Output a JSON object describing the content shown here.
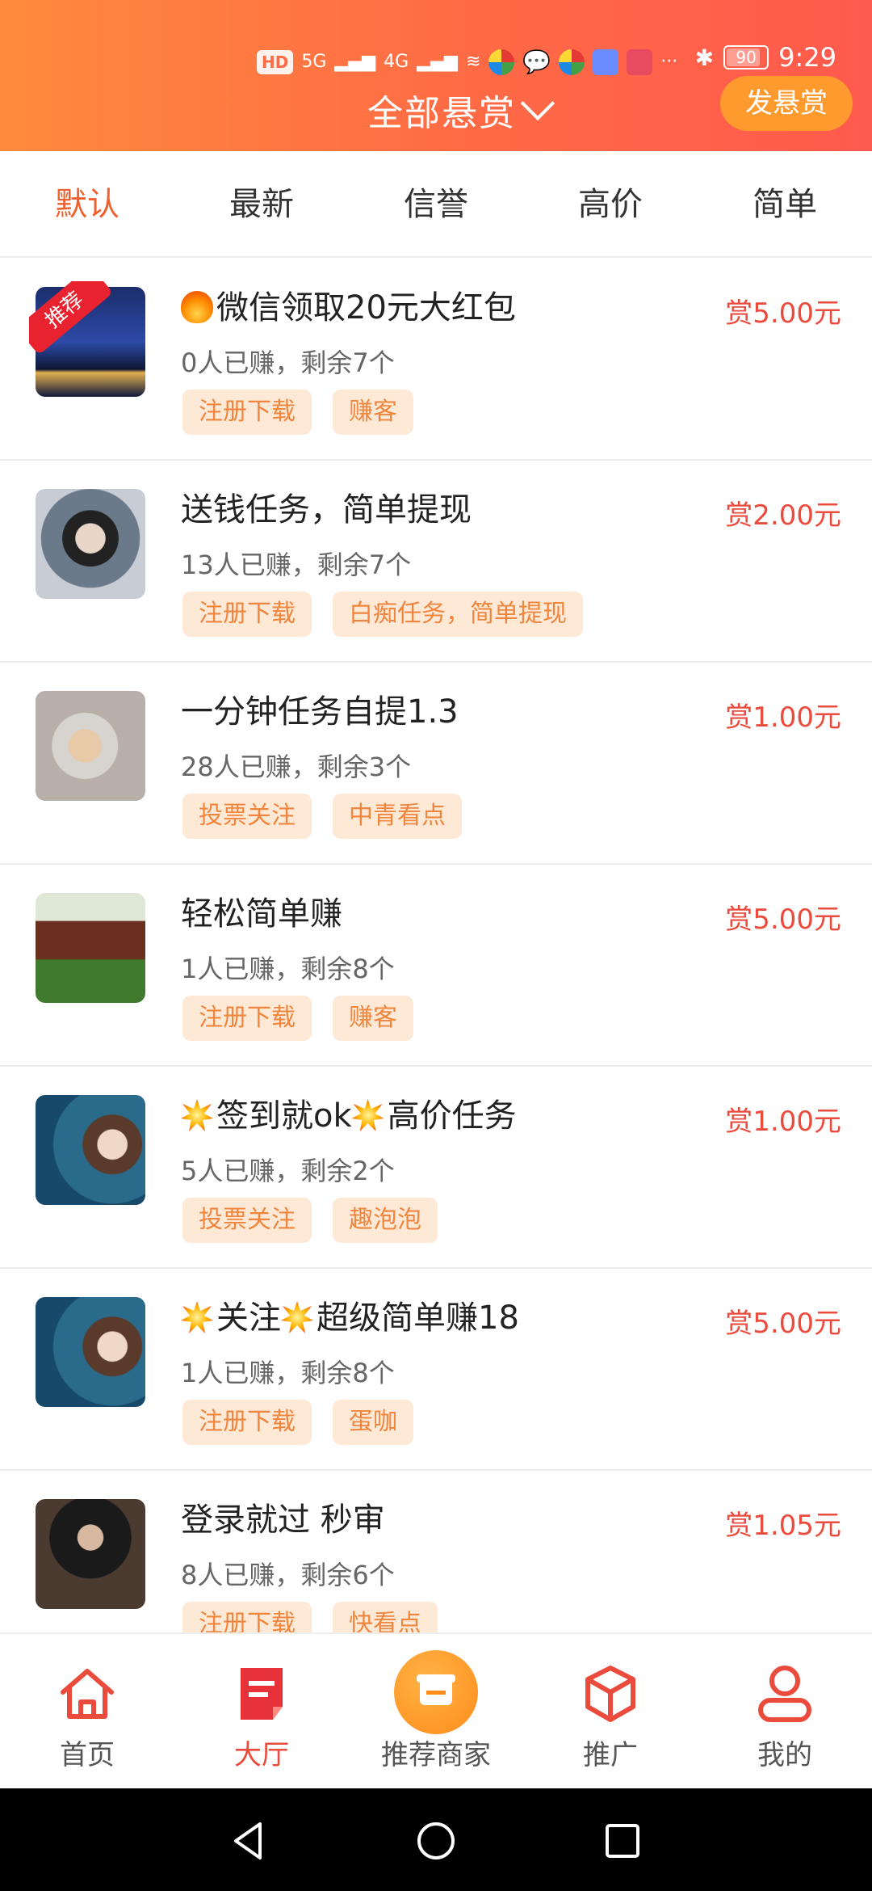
{
  "status_bar": {
    "left_icons": [
      "HD",
      "5G",
      "4G",
      "wifi-icon",
      "app-icons"
    ],
    "battery": "90",
    "time": "9:29"
  },
  "header": {
    "title": "全部悬赏",
    "post_button": "发悬赏",
    "gradient_colors": [
      "#ff8a3d",
      "#ff5a4e"
    ]
  },
  "tabs": [
    {
      "label": "默认",
      "active": true
    },
    {
      "label": "最新",
      "active": false
    },
    {
      "label": "信誉",
      "active": false
    },
    {
      "label": "高价",
      "active": false
    },
    {
      "label": "简单",
      "active": false
    }
  ],
  "tasks": [
    {
      "title": "微信领取20元大红包",
      "title_prefix_icon": "fire-emoji",
      "earned": "0人已赚，剩余7个",
      "tags": [
        "注册下载",
        "赚客"
      ],
      "reward": "赏5.00元",
      "badge": "推荐"
    },
    {
      "title": "送钱任务，简单提现",
      "earned": "13人已赚，剩余7个",
      "tags": [
        "注册下载",
        "白痴任务，简单提现"
      ],
      "reward": "赏2.00元"
    },
    {
      "title": "一分钟任务自提1.3",
      "earned": "28人已赚，剩余3个",
      "tags": [
        "投票关注",
        "中青看点"
      ],
      "reward": "赏1.00元"
    },
    {
      "title": "轻松简单赚",
      "earned": "1人已赚，剩余8个",
      "tags": [
        "注册下载",
        "赚客"
      ],
      "reward": "赏5.00元"
    },
    {
      "title_parts": [
        "签到就ok",
        "高价任务"
      ],
      "earned": "5人已赚，剩余2个",
      "tags": [
        "投票关注",
        "趣泡泡"
      ],
      "reward": "赏1.00元"
    },
    {
      "title_parts": [
        "关注",
        "超级简单赚18"
      ],
      "earned": "1人已赚，剩余8个",
      "tags": [
        "注册下载",
        "蛋咖"
      ],
      "reward": "赏5.00元"
    },
    {
      "title": "登录就过  秒审",
      "earned": "8人已赚，剩余6个",
      "tags": [
        "注册下载",
        "快看点"
      ],
      "reward": "赏1.05元"
    }
  ],
  "bottom_nav": [
    {
      "label": "首页",
      "icon": "home-icon",
      "active": false
    },
    {
      "label": "大厅",
      "icon": "hall-icon",
      "active": true
    },
    {
      "label": "推荐商家",
      "icon": "shop-icon",
      "active": false
    },
    {
      "label": "推广",
      "icon": "cube-icon",
      "active": false
    },
    {
      "label": "我的",
      "icon": "user-icon",
      "active": false
    }
  ],
  "accent_color": "#ea4b3c",
  "tag_color": "#f0863e"
}
